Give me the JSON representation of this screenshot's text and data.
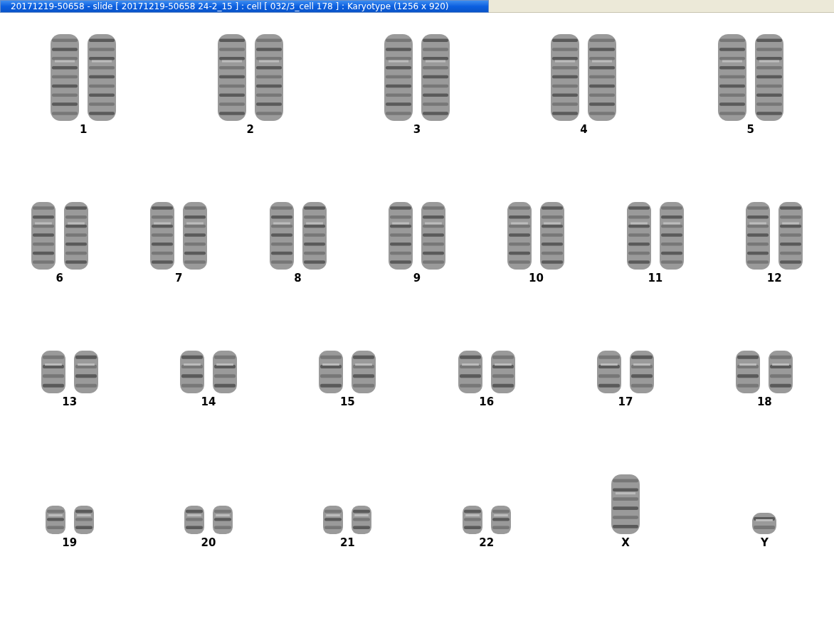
{
  "window": {
    "title": "20171219-50658 - slide [ 20171219-50658 24-2_15 ] : cell [ 032/3_cell 178 ] : Karyotype  (1256 x 920)"
  },
  "karyotype": {
    "rows": [
      {
        "chromosomes": [
          {
            "label": "1",
            "kind": "pair"
          },
          {
            "label": "2",
            "kind": "pair"
          },
          {
            "label": "3",
            "kind": "pair"
          },
          {
            "label": "4",
            "kind": "pair"
          },
          {
            "label": "5",
            "kind": "pair"
          }
        ]
      },
      {
        "chromosomes": [
          {
            "label": "6",
            "kind": "pair"
          },
          {
            "label": "7",
            "kind": "pair"
          },
          {
            "label": "8",
            "kind": "pair"
          },
          {
            "label": "9",
            "kind": "pair"
          },
          {
            "label": "10",
            "kind": "pair"
          },
          {
            "label": "11",
            "kind": "pair"
          },
          {
            "label": "12",
            "kind": "pair"
          }
        ]
      },
      {
        "chromosomes": [
          {
            "label": "13",
            "kind": "pair"
          },
          {
            "label": "14",
            "kind": "pair"
          },
          {
            "label": "15",
            "kind": "pair"
          },
          {
            "label": "16",
            "kind": "pair"
          },
          {
            "label": "17",
            "kind": "pair"
          },
          {
            "label": "18",
            "kind": "pair"
          }
        ]
      },
      {
        "chromosomes": [
          {
            "label": "19",
            "kind": "pair"
          },
          {
            "label": "20",
            "kind": "pair"
          },
          {
            "label": "21",
            "kind": "pair"
          },
          {
            "label": "22",
            "kind": "pair"
          },
          {
            "label": "X",
            "kind": "single_tall"
          },
          {
            "label": "Y",
            "kind": "single_short"
          }
        ]
      }
    ]
  }
}
